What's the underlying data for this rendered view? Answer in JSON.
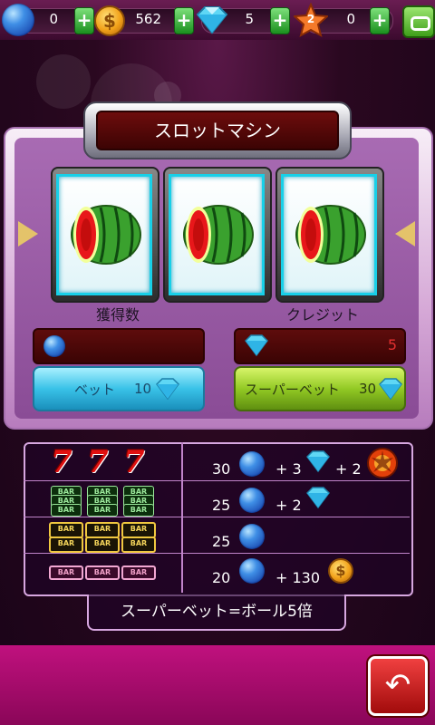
{
  "topbar": {
    "balls": "0",
    "coins": "562",
    "diamonds": "5",
    "star_level": "2",
    "stars": "0"
  },
  "title": "スロットマシン",
  "reels": [
    "watermelon",
    "watermelon",
    "watermelon"
  ],
  "labels": {
    "winnings": "獲得数",
    "credit": "クレジット"
  },
  "credit_value": "5",
  "bet": {
    "label": "ベット",
    "cost": "10"
  },
  "superbet": {
    "label": "スーパーベット",
    "cost": "30"
  },
  "paytable": [
    {
      "symbols": "777",
      "balls": "30",
      "diamonds": "3",
      "special": "2"
    },
    {
      "symbols": "BAR BAR BAR (triple)",
      "balls": "25",
      "diamonds": "2"
    },
    {
      "symbols": "BAR BAR (double)",
      "balls": "25"
    },
    {
      "symbols": "BAR (single)",
      "balls": "20",
      "coins": "130"
    }
  ],
  "bar_text": "BAR",
  "seven_text": "7",
  "footer": "スーパーベット=ボール5倍",
  "icons": {
    "back": "back-arrow-icon"
  }
}
